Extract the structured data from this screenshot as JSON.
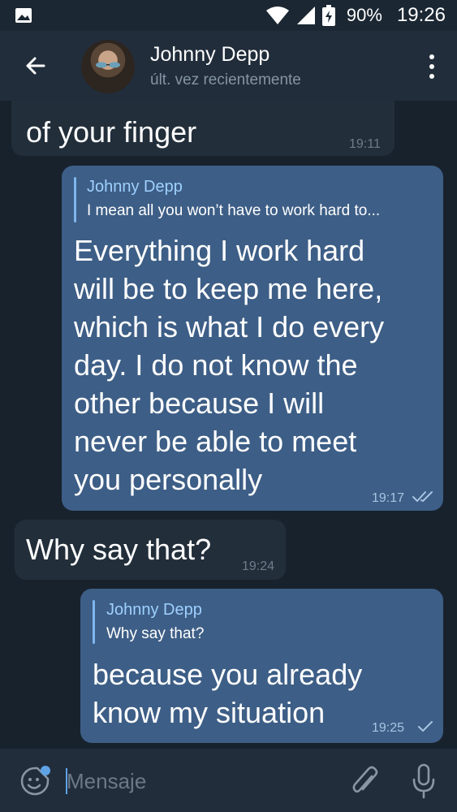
{
  "status_bar": {
    "battery_percent": "90%",
    "time": "19:26",
    "icons": [
      "image-icon",
      "wifi-icon",
      "signal-icon",
      "battery-charging-icon"
    ]
  },
  "header": {
    "contact_name": "Johnny Depp",
    "contact_status": "últ. vez recientemente",
    "icons": [
      "back-arrow-icon",
      "avatar",
      "more-vert-icon"
    ]
  },
  "messages": [
    {
      "direction": "incoming",
      "text": "of your finger",
      "time": "19:11"
    },
    {
      "direction": "outgoing",
      "reply_to_name": "Johnny Depp",
      "reply_to_text": "I mean all you won’t have to work hard to...",
      "text": "Everything I work hard\nwill be to keep me here,\nwhich is what I do every\nday. I do not know the\nother because I will\nnever be able to meet\nyou personally",
      "time": "19:17",
      "status": "read"
    },
    {
      "direction": "incoming",
      "text": "Why say that?",
      "time": "19:24"
    },
    {
      "direction": "outgoing",
      "reply_to_name": "Johnny Depp",
      "reply_to_text": "Why say that?",
      "text": "because you already\nknow my situation",
      "time": "19:25",
      "status": "sent"
    }
  ],
  "input_bar": {
    "placeholder": "Mensaje",
    "icons": [
      "sticker-emoji-icon",
      "paperclip-icon",
      "microphone-icon"
    ]
  },
  "colors": {
    "background": "#18222d",
    "header": "#212d3b",
    "incoming_bubble": "#222e3a",
    "outgoing_bubble": "#3d5e86",
    "reply_name": "#9fd0ff",
    "accent": "#5fa3e6"
  }
}
